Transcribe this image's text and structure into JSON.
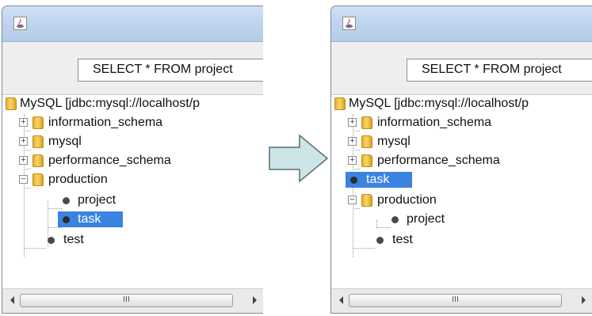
{
  "query": "SELECT * FROM project",
  "left_tree": {
    "root": "MySQL [jdbc:mysql://localhost/p",
    "schemas": [
      "information_schema",
      "mysql",
      "performance_schema",
      "production"
    ],
    "production_children": [
      "project",
      "task"
    ],
    "test": "test",
    "selected": "task"
  },
  "right_tree": {
    "root": "MySQL [jdbc:mysql://localhost/p",
    "schemas": [
      "information_schema",
      "mysql",
      "performance_schema"
    ],
    "moved_item": "task",
    "production": "production",
    "production_children": [
      "project"
    ],
    "test": "test",
    "selected": "task"
  },
  "scrollbar_thumb_glyph": "III",
  "colors": {
    "selection": "#3b83e0",
    "arrow_fill": "#cce6e8",
    "titlebar": "#c3d8ef"
  },
  "icons": [
    "java-app-icon",
    "folder-icon",
    "leaf-icon",
    "arrow-right-icon"
  ]
}
